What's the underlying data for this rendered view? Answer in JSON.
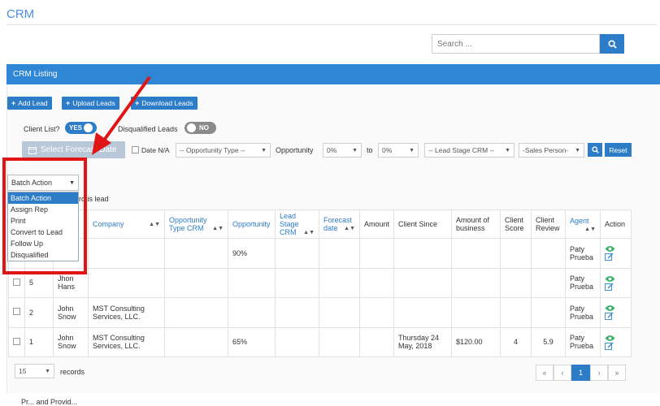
{
  "page": {
    "title": "CRM"
  },
  "search": {
    "placeholder": "Search ..."
  },
  "panel": {
    "heading": "CRM Listing"
  },
  "actions": {
    "add_lead": "Add Lead",
    "upload_leads": "Upload Leads",
    "download_leads": "Download Leads"
  },
  "filters": {
    "client_list_label": "Client List?",
    "client_list_toggle": "YES",
    "disqualified_label": "Disqualified Leads",
    "disqualified_toggle": "NO",
    "forecast_button": "Select Forecast Date",
    "date_na": "Date N/A",
    "opportunity_type": "-- Opportunity Type --",
    "opportunity_label": "Opportunity",
    "opp_from": "0%",
    "to_label": "to",
    "opp_to": "0%",
    "lead_stage": "-- Lead Stage CRM --",
    "sales_person": "-Sales Person-",
    "reset": "Reset"
  },
  "batch": {
    "selected": "Batch Action",
    "options": [
      "Batch Action",
      "Assign Rep",
      "Print",
      "Convert to Lead",
      "Follow Up",
      "Disqualified"
    ],
    "records_text": "rd is lead"
  },
  "table": {
    "headers": {
      "company": "Company",
      "opp_type": "Opportunity Type CRM",
      "opportunity": "Opportunity",
      "lead_stage": "Lead Stage CRM",
      "forecast": "Forecast date",
      "amount": "Amount",
      "client_since": "Client Since",
      "amount_business": "Amount of business",
      "client_score": "Client Score",
      "client_review": "Client Review",
      "agent": "Agent",
      "action": "Action"
    },
    "rows": [
      {
        "id": "",
        "name": "",
        "company": "",
        "opp_type": "",
        "opportunity": "90%",
        "lead_stage": "",
        "forecast": "",
        "amount": "",
        "client_since": "",
        "amount_business": "",
        "score": "",
        "review": "",
        "agent": "Paty Prueba"
      },
      {
        "id": "5",
        "name": "Jhon Hans",
        "company": "",
        "opp_type": "",
        "opportunity": "",
        "lead_stage": "",
        "forecast": "",
        "amount": "",
        "client_since": "",
        "amount_business": "",
        "score": "",
        "review": "",
        "agent": "Paty Prueba"
      },
      {
        "id": "2",
        "name": "John Snow",
        "company": "MST Consulting Services, LLC.",
        "opp_type": "",
        "opportunity": "",
        "lead_stage": "",
        "forecast": "",
        "amount": "",
        "client_since": "",
        "amount_business": "",
        "score": "",
        "review": "",
        "agent": "Paty Prueba"
      },
      {
        "id": "1",
        "name": "John Snow",
        "company": "MST Consulting Services, LLC.",
        "opp_type": "",
        "opportunity": "65%",
        "lead_stage": "",
        "forecast": "",
        "amount": "",
        "client_since": "Thursday 24 May, 2018",
        "amount_business": "$120.00",
        "score": "4",
        "review": "5.9",
        "agent": "Paty Prueba"
      }
    ]
  },
  "pagination": {
    "per_page": "15",
    "records_label": "records",
    "first": "«",
    "prev": "‹",
    "current": "1",
    "next": "›",
    "last": "»"
  },
  "footer": {
    "text": "Pr... and Provid..."
  },
  "colors": {
    "primary": "#2d7cc8",
    "header": "#2e86d4",
    "toggle_yes": "#2d7cc8",
    "toggle_no": "#8a8a8a",
    "highlight": "#e01515",
    "eye": "#3bb36b"
  }
}
